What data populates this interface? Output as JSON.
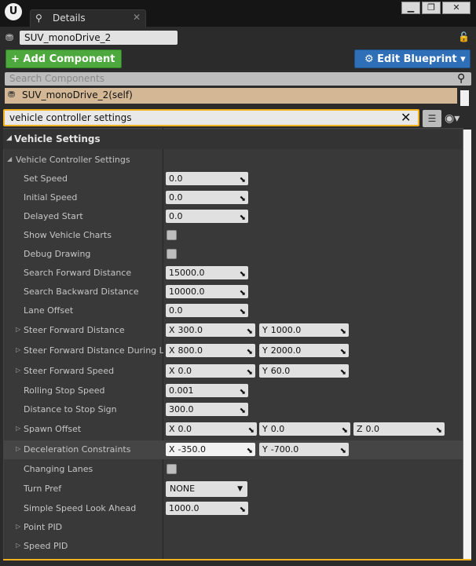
{
  "window": {
    "logo": "U",
    "tab_label": "Details",
    "tab_close": "✕",
    "min": "▁",
    "max": "❐",
    "close": "✕"
  },
  "actor": {
    "name": "SUV_monoDrive_2"
  },
  "toolbar": {
    "add_component": "+ Add Component ▾",
    "edit_blueprint": "⚙ Edit Blueprint ▾"
  },
  "components": {
    "search_placeholder": "Search Components",
    "self_label": "SUV_monoDrive_2(self)"
  },
  "filter": {
    "value": "vehicle controller settings"
  },
  "details": {
    "category": "Vehicle Settings",
    "subcategory": "Vehicle Controller Settings",
    "props": {
      "set_speed": {
        "label": "Set Speed",
        "value": "0.0"
      },
      "initial_speed": {
        "label": "Initial Speed",
        "value": "0.0"
      },
      "delayed_start": {
        "label": "Delayed Start",
        "value": "0.0"
      },
      "show_vehicle_charts": {
        "label": "Show Vehicle Charts"
      },
      "debug_drawing": {
        "label": "Debug Drawing"
      },
      "search_forward": {
        "label": "Search Forward Distance",
        "value": "15000.0"
      },
      "search_backward": {
        "label": "Search Backward Distance",
        "value": "10000.0"
      },
      "lane_offset": {
        "label": "Lane Offset",
        "value": "0.0"
      },
      "steer_forward": {
        "label": "Steer Forward Distance",
        "x": "300.0",
        "y": "1000.0"
      },
      "steer_forward_lane": {
        "label": "Steer Forward Distance During Lane Change",
        "x": "800.0",
        "y": "2000.0"
      },
      "steer_speed": {
        "label": "Steer Forward Speed",
        "x": "0.0",
        "y": "60.0"
      },
      "rolling_stop": {
        "label": "Rolling Stop Speed",
        "value": "0.001"
      },
      "dist_stop": {
        "label": "Distance to Stop Sign",
        "value": "300.0"
      },
      "spawn_offset": {
        "label": "Spawn Offset",
        "x": "0.0",
        "y": "0.0",
        "z": "0.0"
      },
      "decel": {
        "label": "Deceleration Constraints",
        "x": "-350.0",
        "y": "-700.0"
      },
      "changing_lanes": {
        "label": "Changing Lanes"
      },
      "turn_pref": {
        "label": "Turn Pref",
        "value": "NONE"
      },
      "look_ahead": {
        "label": "Simple Speed Look Ahead",
        "value": "1000.0"
      },
      "point_pid": {
        "label": "Point PID"
      },
      "speed_pid": {
        "label": "Speed PID"
      }
    },
    "axis": {
      "x": "X",
      "y": "Y",
      "z": "Z"
    }
  },
  "icons": {
    "search": "⚲",
    "clear": "✕",
    "lock": "🔓",
    "list": "☰",
    "eye": "◉▾",
    "expand": "▷",
    "collapse": "◢",
    "grip": "⬊",
    "caret": "▼"
  }
}
